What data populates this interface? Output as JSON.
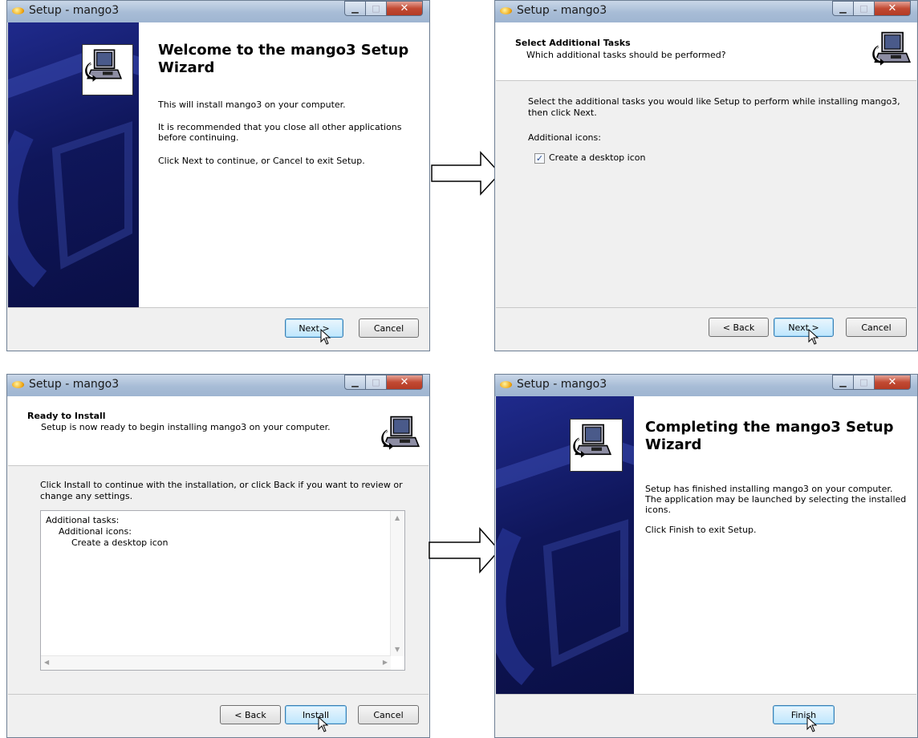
{
  "windows": {
    "welcome": {
      "title": "Setup - mango3",
      "heading": "Welcome to the mango3 Setup Wizard",
      "p1": "This will install mango3 on your computer.",
      "p2": "It is recommended that you close all other applications before continuing.",
      "p3": "Click Next to continue, or Cancel to exit Setup.",
      "next_label": "Next >",
      "cancel_label": "Cancel"
    },
    "tasks": {
      "title": "Setup - mango3",
      "header_title": "Select Additional Tasks",
      "header_subtitle": "Which additional tasks should be performed?",
      "intro": "Select the additional tasks you would like Setup to perform while installing mango3, then click Next.",
      "group_label": "Additional icons:",
      "checkbox_label": "Create a desktop icon",
      "checkbox_checked": true,
      "back_label": "< Back",
      "next_label": "Next >",
      "cancel_label": "Cancel"
    },
    "ready": {
      "title": "Setup - mango3",
      "header_title": "Ready to Install",
      "header_subtitle": "Setup is now ready to begin installing mango3 on your computer.",
      "intro": "Click Install to continue with the installation, or click Back if you want to review or change any settings.",
      "memo_line1": "Additional tasks:",
      "memo_line2": "Additional icons:",
      "memo_line3": "Create a desktop icon",
      "back_label": "< Back",
      "install_label": "Install",
      "cancel_label": "Cancel"
    },
    "finish": {
      "title": "Setup - mango3",
      "heading": "Completing the mango3 Setup Wizard",
      "p1": "Setup has finished installing mango3 on your computer. The application may be launched by selecting the installed icons.",
      "p2": "Click Finish to exit Setup.",
      "finish_label": "Finish"
    }
  },
  "icons": [
    "app-icon",
    "minimize-icon",
    "maximize-icon",
    "close-icon",
    "computer-install-icon",
    "checkmark-icon",
    "arrow-right-icon",
    "mouse-cursor-icon"
  ]
}
